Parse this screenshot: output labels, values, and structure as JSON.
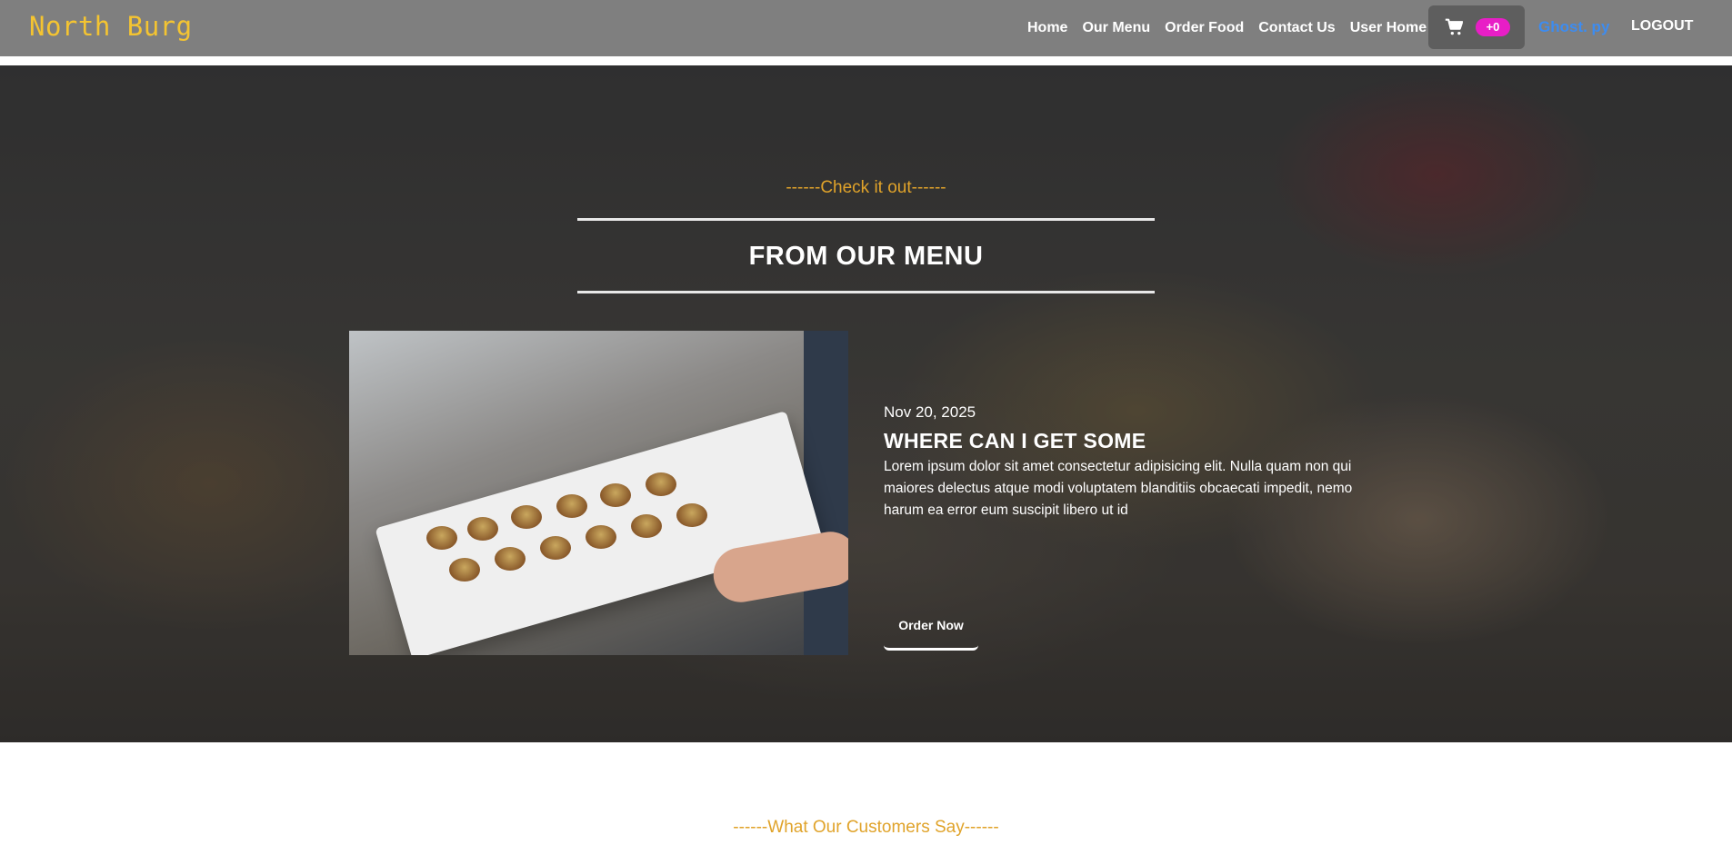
{
  "navbar": {
    "brand": "North Burg",
    "links": [
      "Home",
      "Our Menu",
      "Order Food",
      "Contact Us",
      "User Home"
    ],
    "cart_count": "+0",
    "user_name": "Ghost. py",
    "logout": "LOGOUT"
  },
  "hero": {
    "kicker": "------Check it out------",
    "title": "FROM OUR MENU",
    "post": {
      "date": "Nov 20, 2025",
      "title": "WHERE CAN I GET SOME",
      "body": "Lorem ipsum dolor sit amet consectetur adipisicing elit. Nulla quam non qui maiores delectus atque modi voluptatem blanditiis obcaecati impedit, nemo harum ea error eum suscipit libero ut id",
      "button": "Order Now"
    }
  },
  "testimonials": {
    "kicker": "------What Our Customers Say------"
  },
  "colors": {
    "brand": "#f4c431",
    "accent": "#e0a32a",
    "badge": "#e81ec6",
    "user_link": "#3d8cf0",
    "navbar_bg": "#7f7f7f"
  },
  "icons": {
    "cart": "cart-icon"
  }
}
